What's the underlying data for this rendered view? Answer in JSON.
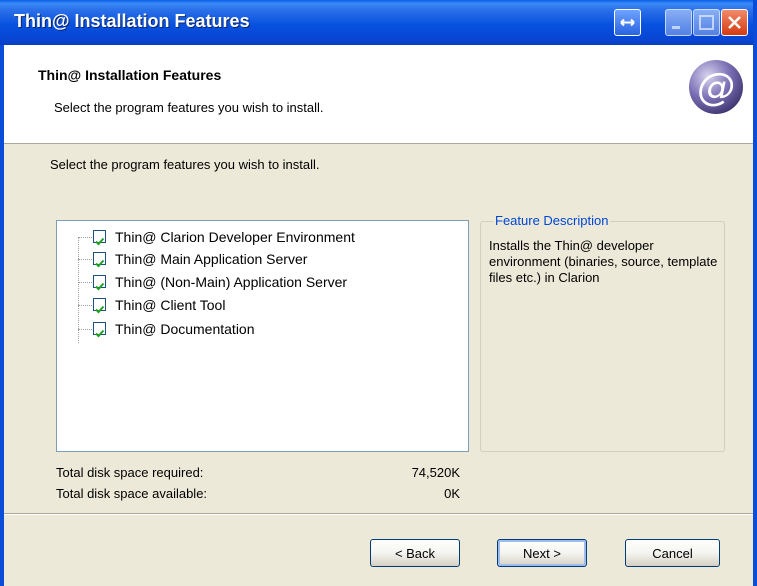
{
  "window": {
    "title": "Thin@ Installation Features"
  },
  "header": {
    "title": "Thin@ Installation Features",
    "subtitle": "Select the program features you wish to install."
  },
  "main": {
    "instruction": "Select the program features you wish to install.",
    "features": [
      {
        "label": "Thin@ Clarion Developer Environment",
        "checked": true
      },
      {
        "label": "Thin@ Main Application Server",
        "checked": true
      },
      {
        "label": "Thin@ (Non-Main) Application Server",
        "checked": true
      },
      {
        "label": "Thin@ Client Tool",
        "checked": true
      },
      {
        "label": "Thin@ Documentation",
        "checked": true
      }
    ],
    "feature_description": {
      "legend": "Feature Description",
      "text": "Installs the Thin@ developer environment (binaries, source, template files etc.) in Clarion"
    },
    "disk_space": {
      "required_label": "Total disk space required:",
      "required_value": "74,520K",
      "available_label": "Total disk space available:",
      "available_value": "0K"
    }
  },
  "buttons": {
    "back": "< Back",
    "next": "Next >",
    "cancel": "Cancel"
  },
  "colors": {
    "titlebar": "#0851df",
    "accent": "#0046d5",
    "checkmark": "#21a121"
  }
}
